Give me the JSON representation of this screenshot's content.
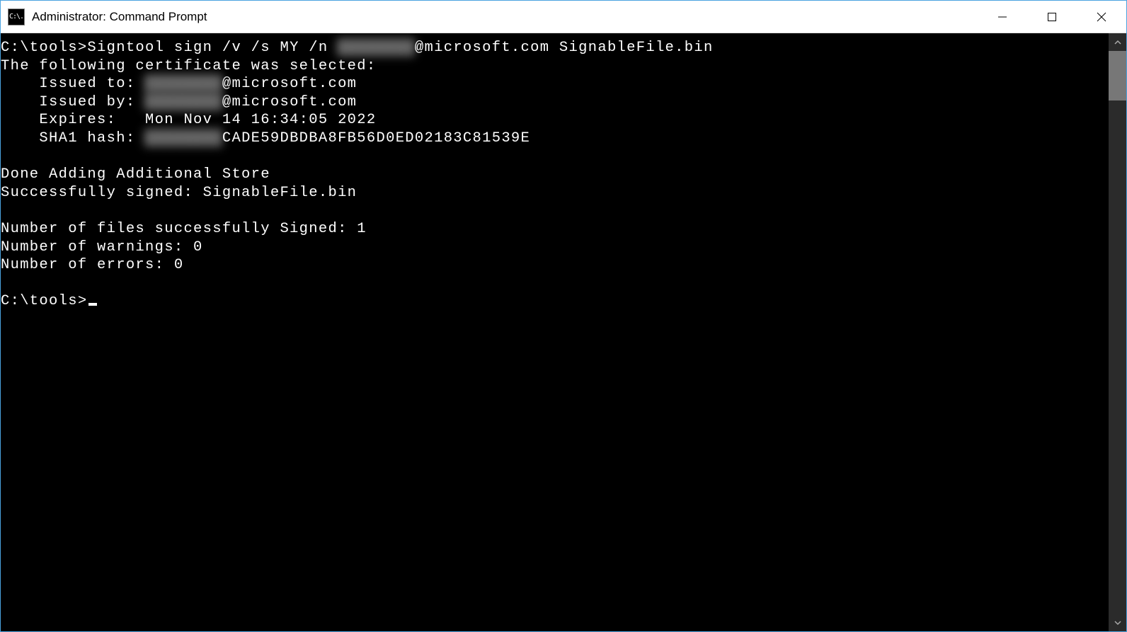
{
  "window": {
    "title": "Administrator: Command Prompt",
    "icon_label": "C:\\."
  },
  "terminal": {
    "prompt1_path": "C:\\tools>",
    "command_head": "Signtool sign /v /s MY /n ",
    "command_redacted": "████████",
    "command_tail": "@microsoft.com SignableFile.bin",
    "cert_selected": "The following certificate was selected:",
    "issued_to_label": "    Issued to: ",
    "issued_to_redacted": "████████",
    "issued_to_tail": "@microsoft.com",
    "issued_by_label": "    Issued by: ",
    "issued_by_redacted": "████████",
    "issued_by_tail": "@microsoft.com",
    "expires_label": "    Expires:   ",
    "expires_value": "Mon Nov 14 16:34:05 2022",
    "sha1_label": "    SHA1 hash: ",
    "sha1_redacted": "████████",
    "sha1_tail": "CADE59DBDBA8FB56D0ED02183C81539E",
    "done_store": "Done Adding Additional Store",
    "success_signed": "Successfully signed: SignableFile.bin",
    "num_signed": "Number of files successfully Signed: 1",
    "num_warn": "Number of warnings: 0",
    "num_err": "Number of errors: 0",
    "prompt2_path": "C:\\tools>"
  }
}
